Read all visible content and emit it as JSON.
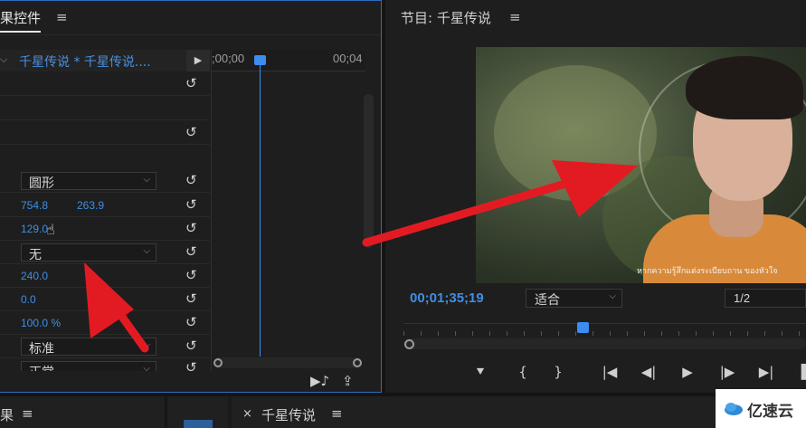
{
  "effect_controls": {
    "title": "果控件",
    "clip_name": "千星传说 * 千星传说....",
    "timecode_start": ";00;00",
    "timecode_end": "00;04",
    "rows": {
      "shape_value": "圆形",
      "center_x": "754.8",
      "center_y": "263.9",
      "size_value": "129.0",
      "feather_dd": "无",
      "val_240": "240.0",
      "val_0": "0.0",
      "val_percent": "100.0 %",
      "blend_dd": "标准",
      "partial_dd": "正常"
    }
  },
  "program_monitor": {
    "title": "节目: 千星传说",
    "timecode": "00;01;35;19",
    "fit_value": "适合",
    "resolution": "1/2",
    "subtitle": "หากความรู้สึกแต่งระเบียบถาน ของหัวใจ"
  },
  "bottom_panels": {
    "tab1_label": "果",
    "tab3_label": "千星传说"
  },
  "watermark": {
    "text": "亿速云"
  },
  "icons": {
    "menu": "≡",
    "reset": "↺",
    "close": "×"
  },
  "colors": {
    "accent_blue": "#3f8ee6",
    "arrow_red": "#e21b23",
    "panel_bg": "#1e1e1e"
  }
}
